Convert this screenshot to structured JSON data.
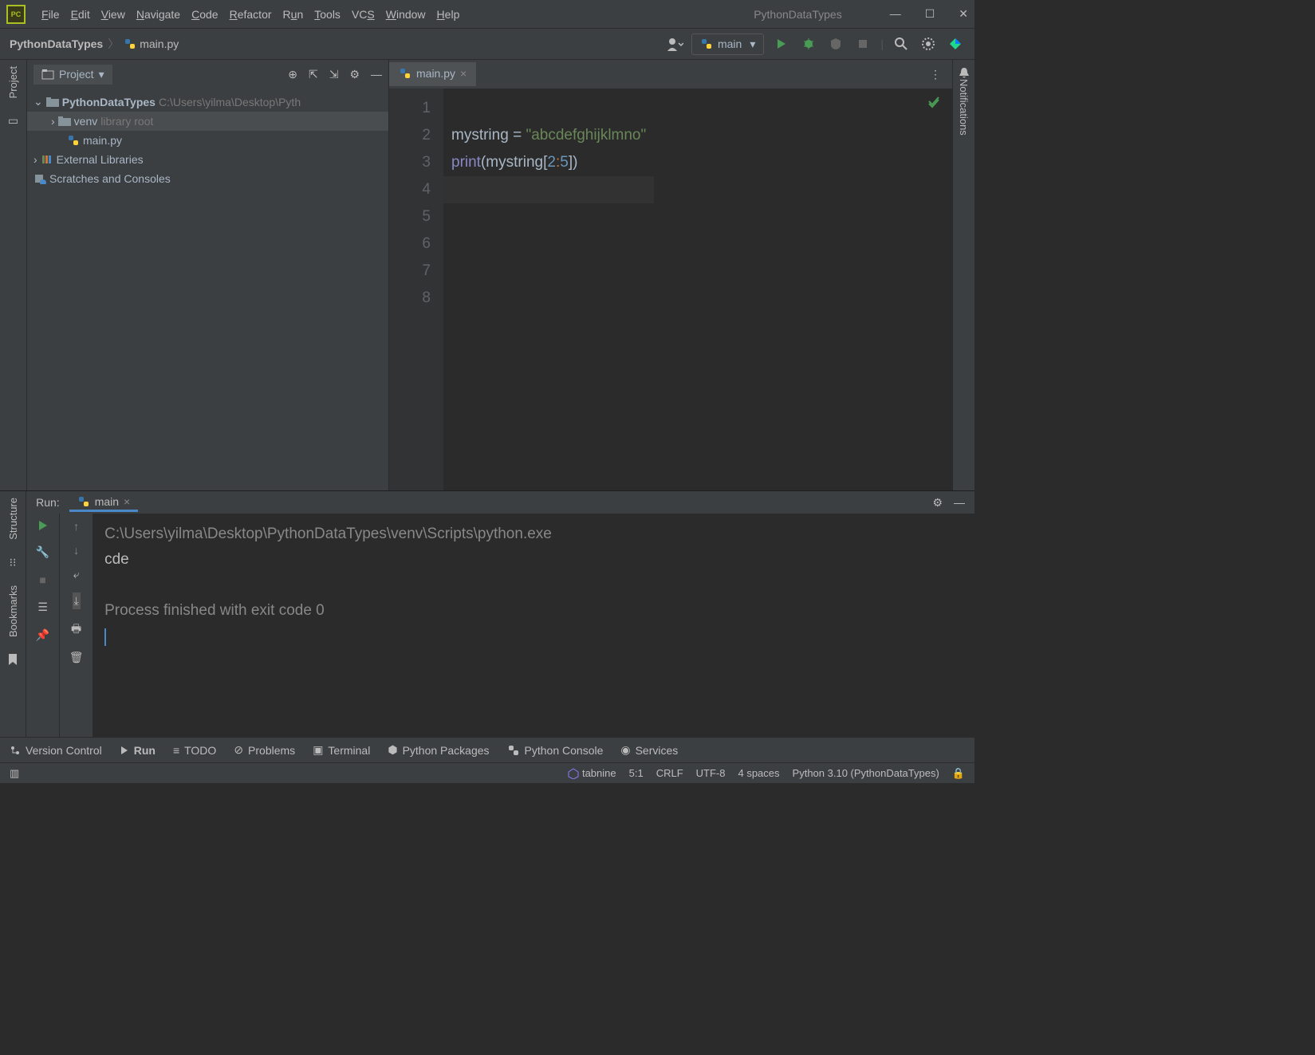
{
  "window": {
    "title": "PythonDataTypes"
  },
  "menu": {
    "file": "File",
    "edit": "Edit",
    "view": "View",
    "navigate": "Navigate",
    "code": "Code",
    "refactor": "Refactor",
    "run": "Run",
    "tools": "Tools",
    "vcs": "VCS",
    "window": "Window",
    "help": "Help"
  },
  "breadcrumb": {
    "project": "PythonDataTypes",
    "file": "main.py"
  },
  "runConfig": {
    "label": "main"
  },
  "projectPanel": {
    "title": "Project",
    "root": "PythonDataTypes",
    "rootPath": "C:\\Users\\yilma\\Desktop\\Pyth",
    "venv": "venv",
    "venvHint": "library root",
    "mainFile": "main.py",
    "external": "External Libraries",
    "scratches": "Scratches and Consoles"
  },
  "editor": {
    "tabName": "main.py",
    "lines": [
      "1",
      "2",
      "3",
      "4",
      "5",
      "6",
      "7",
      "8"
    ],
    "code": {
      "l1_var": "mystring",
      "l1_eq": " = ",
      "l1_str": "\"abcdefghijklmno\"",
      "l2_fn": "print",
      "l2_p1": "(",
      "l2_var": "mystring",
      "l2_b1": "[",
      "l2_n1": "2",
      "l2_c": ":",
      "l2_n2": "5",
      "l2_b2": "]",
      "l2_p2": ")"
    }
  },
  "runPanel": {
    "label": "Run:",
    "tab": "main",
    "line1": "C:\\Users\\yilma\\Desktop\\PythonDataTypes\\venv\\Scripts\\python.exe",
    "line2": "cde",
    "line3": "Process finished with exit code 0"
  },
  "leftRail": {
    "project": "Project",
    "structure": "Structure",
    "bookmarks": "Bookmarks"
  },
  "rightRail": {
    "notifications": "Notifications"
  },
  "bottomBar": {
    "versionControl": "Version Control",
    "run": "Run",
    "todo": "TODO",
    "problems": "Problems",
    "terminal": "Terminal",
    "pythonPackages": "Python Packages",
    "pythonConsole": "Python Console",
    "services": "Services"
  },
  "statusBar": {
    "tabnine": "tabnine",
    "position": "5:1",
    "lineEnding": "CRLF",
    "encoding": "UTF-8",
    "indent": "4 spaces",
    "interpreter": "Python 3.10 (PythonDataTypes)"
  }
}
